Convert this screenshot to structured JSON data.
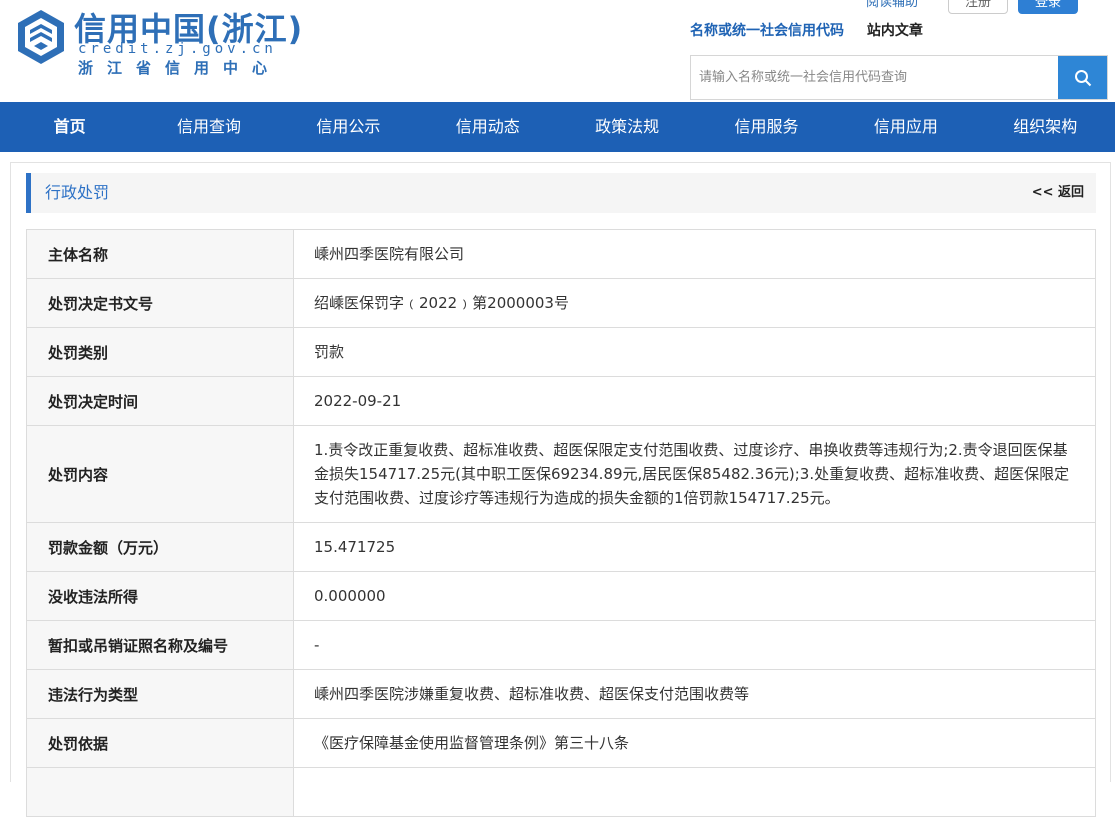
{
  "brand": {
    "title": "信用中国(浙江)",
    "domain": "credit.zj.gov.cn",
    "subtitle": "浙江省信用中心"
  },
  "top": {
    "accessibility": "阅读辅助",
    "register": "注册",
    "login": "登录"
  },
  "search": {
    "tabs": [
      "名称或统一社会信用代码",
      "站内文章"
    ],
    "placeholder": "请输入名称或统一社会信用代码查询"
  },
  "nav": [
    "首页",
    "信用查询",
    "信用公示",
    "信用动态",
    "政策法规",
    "信用服务",
    "信用应用",
    "组织架构"
  ],
  "section": {
    "title": "行政处罚",
    "back": "<< 返回"
  },
  "rows": [
    {
      "label": "主体名称",
      "value": "嵊州四季医院有限公司"
    },
    {
      "label": "处罚决定书文号",
      "value": "绍嵊医保罚字﹙2022﹚第2000003号"
    },
    {
      "label": "处罚类别",
      "value": "罚款"
    },
    {
      "label": "处罚决定时间",
      "value": "2022-09-21"
    },
    {
      "label": "处罚内容",
      "value": "1.责令改正重复收费、超标准收费、超医保限定支付范围收费、过度诊疗、串换收费等违规行为;2.责令退回医保基金损失154717.25元(其中职工医保69234.89元,居民医保85482.36元);3.处重复收费、超标准收费、超医保限定支付范围收费、过度诊疗等违规行为造成的损失金额的1倍罚款154717.25元。"
    },
    {
      "label": "罚款金额（万元）",
      "value": "15.471725"
    },
    {
      "label": "没收违法所得",
      "value": "0.000000"
    },
    {
      "label": "暂扣或吊销证照名称及编号",
      "value": "-"
    },
    {
      "label": "违法行为类型",
      "value": "嵊州四季医院涉嫌重复收费、超标准收费、超医保支付范围收费等"
    },
    {
      "label": "处罚依据",
      "value": "《医疗保障基金使用监督管理条例》第三十八条"
    },
    {
      "label": "",
      "value": ""
    }
  ],
  "colors": {
    "brand_blue": "#2e6fb7",
    "nav_blue": "#1d60b5",
    "search_button": "#2e86d6"
  }
}
